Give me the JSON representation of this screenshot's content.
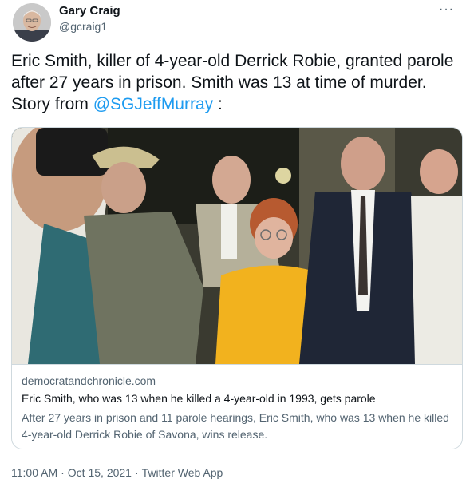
{
  "author": {
    "name": "Gary Craig",
    "handle": "@gcraig1"
  },
  "menu": {
    "glyph": "···"
  },
  "tweet": {
    "text_before": "Eric Smith, killer of 4-year-old Derrick Robie, granted parole after 27 years in prison. Smith was 13 at time of murder. Story from ",
    "mention": "@SGJeffMurray",
    "text_after": " :"
  },
  "card": {
    "domain": "democratandchronicle.com",
    "title": "Eric Smith, who was 13 when he killed a 4-year-old in 1993, gets parole",
    "description": "After 27 years in prison and 11 parole hearings, Eric Smith, who was 13 when he killed 4-year-old Derrick Robie of Savona, wins release."
  },
  "footer": {
    "time": "11:00 AM",
    "date": "Oct 15, 2021",
    "source": "Twitter Web App",
    "separator": "·"
  },
  "colors": {
    "link": "#1d9bf0",
    "secondary": "#536471",
    "primary": "#0f1419",
    "border": "#cfd9de"
  }
}
